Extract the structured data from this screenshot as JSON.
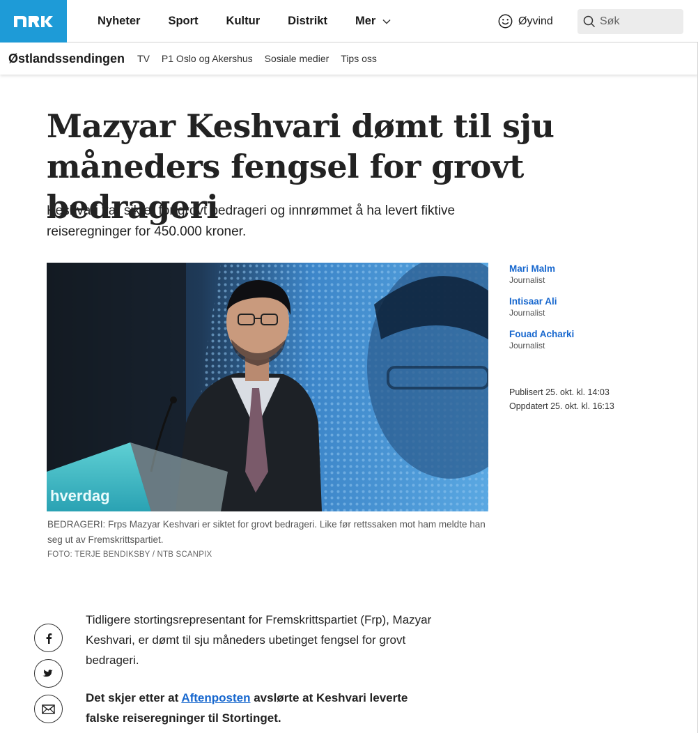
{
  "header": {
    "logo_text": "NRK",
    "nav": [
      {
        "label": "Nyheter"
      },
      {
        "label": "Sport"
      },
      {
        "label": "Kultur"
      },
      {
        "label": "Distrikt"
      },
      {
        "label": "Mer"
      }
    ],
    "user_name": "Øyvind",
    "search_placeholder": "Søk"
  },
  "subnav": {
    "brand": "Østlandssendingen",
    "items": [
      {
        "label": "TV"
      },
      {
        "label": "P1 Oslo og Akershus"
      },
      {
        "label": "Sosiale medier"
      },
      {
        "label": "Tips oss"
      }
    ]
  },
  "article": {
    "headline": "Mazyar Keshvari dømt til sju måneders fengsel for grovt bedrageri",
    "lead": "Keshvari var siktet for grovt bedrageri og innrømmet å ha levert fiktive reiseregninger for 450.000 kroner.",
    "image": {
      "sign_text": "hverdag",
      "caption": "BEDRAGERI: Frps Mazyar Keshvari er siktet for grovt bedrageri. Like før rettssaken mot ham meldte han seg ut av Fremskrittspartiet.",
      "credit": "FOTO: TERJE BENDIKSBY / NTB SCANPIX"
    },
    "authors": [
      {
        "name": "Mari Malm",
        "role": "Journalist"
      },
      {
        "name": "Intisaar Ali",
        "role": "Journalist"
      },
      {
        "name": "Fouad Acharki",
        "role": "Journalist"
      }
    ],
    "published": "Publisert 25. okt. kl. 14:03",
    "updated": "Oppdatert 25. okt. kl. 16:13",
    "body": {
      "p1": "Tidligere stortingsrepresentant for Fremskrittspartiet (Frp), Mazyar Keshvari, er dømt til sju måneders ubetinget fengsel for grovt bedrageri.",
      "p2_before": "Det skjer etter at ",
      "p2_link": "Aftenposten",
      "p2_after": " avslørte at Keshvari leverte falske reiseregninger til Stortinget."
    },
    "share": [
      {
        "icon": "facebook-icon"
      },
      {
        "icon": "twitter-icon"
      },
      {
        "icon": "email-icon"
      }
    ]
  },
  "colors": {
    "brand_blue": "#1e9bd7",
    "link_blue": "#1767ce"
  }
}
